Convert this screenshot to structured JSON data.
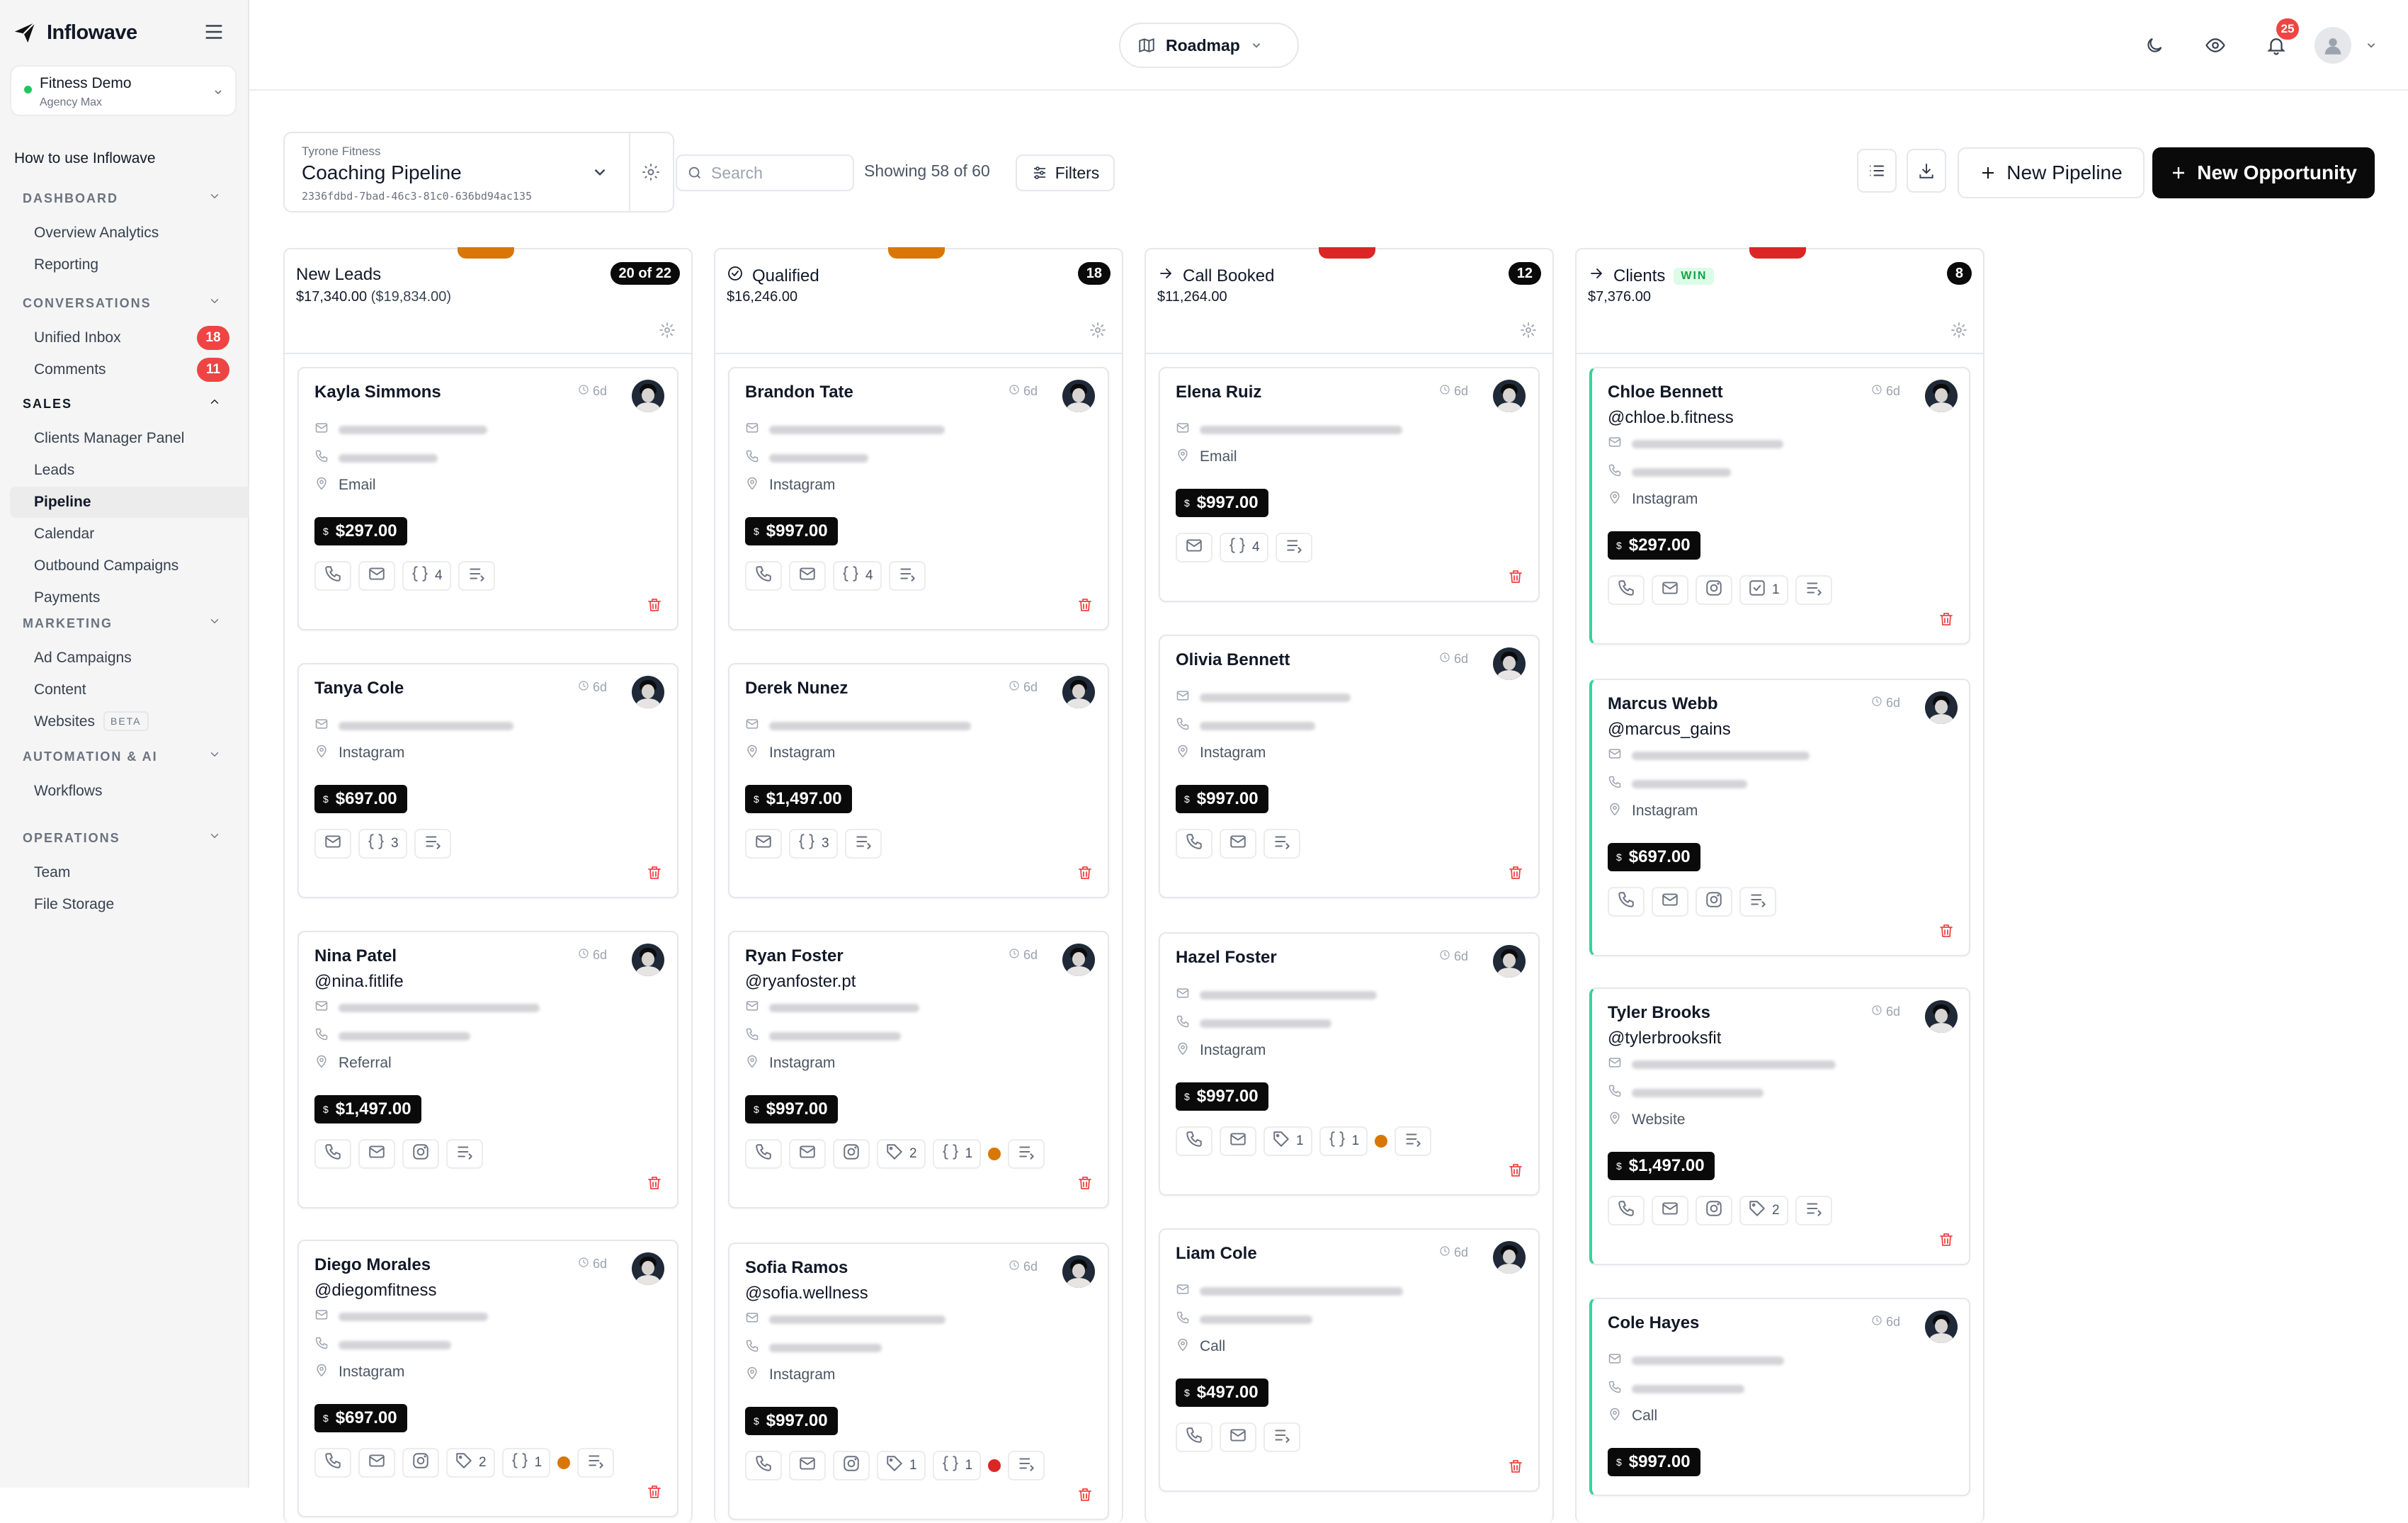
{
  "app": {
    "name": "Inflowave"
  },
  "account": {
    "name": "Fitness Demo",
    "plan": "Agency Max"
  },
  "howto": "How to use Inflowave",
  "sidebar": {
    "sections": [
      {
        "title": "DASHBOARD",
        "items": [
          "Overview Analytics",
          "Reporting"
        ]
      },
      {
        "title": "CONVERSATIONS",
        "items": [
          "Unified Inbox",
          "Comments"
        ],
        "badges": [
          "18",
          "11"
        ]
      },
      {
        "title": "SALES",
        "items": [
          "Clients Manager Panel",
          "Leads",
          "Pipeline",
          "Calendar",
          "Outbound Campaigns",
          "Payments"
        ],
        "active": "Pipeline"
      },
      {
        "title": "MARKETING",
        "items": [
          "Ad Campaigns",
          "Content",
          "Websites"
        ],
        "beta": "BETA"
      },
      {
        "title": "AUTOMATION & AI",
        "items": [
          "Workflows"
        ]
      },
      {
        "title": "OPERATIONS",
        "items": [
          "Team",
          "File Storage"
        ]
      }
    ]
  },
  "topbar": {
    "roadmap": "Roadmap",
    "notifications": "25"
  },
  "pipeline": {
    "owner": "Tyrone Fitness",
    "name": "Coaching Pipeline",
    "id": "2336fdbd-7bad-46c3-81c0-636bd94ac135",
    "search_placeholder": "Search",
    "showing": "Showing 58 of 60",
    "filters": "Filters",
    "new_pipeline": "New Pipeline",
    "new_opportunity": "New Opportunity"
  },
  "columns": [
    {
      "title": "New Leads",
      "amount": "$17,340.00",
      "sub": "($19,834.00)",
      "count": "20 of 22",
      "tab_color": "#d97706",
      "cards": [
        {
          "name": "Kayla Simmons",
          "age": "6d",
          "source": "Email",
          "price": "$297.00",
          "actions": [
            {
              "t": "phone"
            },
            {
              "t": "mail"
            },
            {
              "t": "code",
              "n": "4"
            },
            {
              "t": "notes"
            }
          ]
        },
        {
          "name": "Tanya Cole",
          "age": "6d",
          "source": "Instagram",
          "price": "$697.00",
          "nophone": true,
          "actions": [
            {
              "t": "mail"
            },
            {
              "t": "code",
              "n": "3"
            },
            {
              "t": "notes"
            }
          ]
        },
        {
          "name": "Nina Patel",
          "handle": "@nina.fitlife",
          "age": "6d",
          "source": "Referral",
          "price": "$1,497.00",
          "actions": [
            {
              "t": "phone"
            },
            {
              "t": "mail"
            },
            {
              "t": "insta"
            },
            {
              "t": "notes"
            }
          ]
        },
        {
          "name": "Diego Morales",
          "handle": "@diegomfitness",
          "age": "6d",
          "source": "Instagram",
          "price": "$697.00",
          "actions": [
            {
              "t": "phone"
            },
            {
              "t": "mail"
            },
            {
              "t": "insta"
            },
            {
              "t": "tag",
              "n": "2"
            },
            {
              "t": "code",
              "n": "1"
            },
            {
              "t": "dot",
              "c": "#d97706"
            },
            {
              "t": "notes"
            }
          ]
        }
      ]
    },
    {
      "title": "Qualified",
      "amount": "$16,246.00",
      "count": "18",
      "tab_color": "#d97706",
      "cards": [
        {
          "name": "Brandon Tate",
          "age": "6d",
          "source": "Instagram",
          "price": "$997.00",
          "actions": [
            {
              "t": "phone"
            },
            {
              "t": "mail"
            },
            {
              "t": "code",
              "n": "4"
            },
            {
              "t": "notes"
            }
          ]
        },
        {
          "name": "Derek Nunez",
          "age": "6d",
          "source": "Instagram",
          "price": "$1,497.00",
          "nophone": true,
          "actions": [
            {
              "t": "mail"
            },
            {
              "t": "code",
              "n": "3"
            },
            {
              "t": "notes"
            }
          ]
        },
        {
          "name": "Ryan Foster",
          "handle": "@ryanfoster.pt",
          "age": "6d",
          "source": "Instagram",
          "price": "$997.00",
          "actions": [
            {
              "t": "phone"
            },
            {
              "t": "mail"
            },
            {
              "t": "insta"
            },
            {
              "t": "tag",
              "n": "2"
            },
            {
              "t": "code",
              "n": "1"
            },
            {
              "t": "dot",
              "c": "#d97706"
            },
            {
              "t": "notes"
            }
          ]
        },
        {
          "name": "Sofia Ramos",
          "handle": "@sofia.wellness",
          "age": "6d",
          "source": "Instagram",
          "price": "$997.00",
          "actions": [
            {
              "t": "phone"
            },
            {
              "t": "mail"
            },
            {
              "t": "insta"
            },
            {
              "t": "tag",
              "n": "1"
            },
            {
              "t": "code",
              "n": "1"
            },
            {
              "t": "dot",
              "c": "#dc2626"
            },
            {
              "t": "notes"
            }
          ]
        }
      ]
    },
    {
      "title": "Call Booked",
      "amount": "$11,264.00",
      "count": "12",
      "tab_color": "#dc2626",
      "cards": [
        {
          "name": "Elena Ruiz",
          "age": "6d",
          "source": "Email",
          "price": "$997.00",
          "nophone": true,
          "actions": [
            {
              "t": "mail"
            },
            {
              "t": "code",
              "n": "4"
            },
            {
              "t": "notes"
            }
          ]
        },
        {
          "name": "Olivia Bennett",
          "age": "6d",
          "source": "Instagram",
          "price": "$997.00",
          "actions": [
            {
              "t": "phone"
            },
            {
              "t": "mail"
            },
            {
              "t": "notes"
            }
          ]
        },
        {
          "name": "Hazel Foster",
          "age": "6d",
          "source": "Instagram",
          "price": "$997.00",
          "actions": [
            {
              "t": "phone"
            },
            {
              "t": "mail"
            },
            {
              "t": "tag",
              "n": "1"
            },
            {
              "t": "code",
              "n": "1"
            },
            {
              "t": "dot",
              "c": "#d97706"
            },
            {
              "t": "notes"
            }
          ]
        },
        {
          "name": "Liam Cole",
          "age": "6d",
          "source": "Call",
          "price": "$497.00",
          "actions": [
            {
              "t": "phone"
            },
            {
              "t": "mail"
            },
            {
              "t": "notes"
            }
          ]
        }
      ]
    },
    {
      "title": "Clients",
      "amount": "$7,376.00",
      "count": "8",
      "win": "WIN",
      "tab_color": "#dc2626",
      "cards": [
        {
          "name": "Chloe Bennett",
          "handle": "@chloe.b.fitness",
          "age": "6d",
          "source": "Instagram",
          "price": "$297.00",
          "actions": [
            {
              "t": "phone"
            },
            {
              "t": "mail"
            },
            {
              "t": "insta"
            },
            {
              "t": "check",
              "n": "1"
            },
            {
              "t": "notes"
            }
          ]
        },
        {
          "name": "Marcus Webb",
          "handle": "@marcus_gains",
          "age": "6d",
          "source": "Instagram",
          "price": "$697.00",
          "actions": [
            {
              "t": "phone"
            },
            {
              "t": "mail"
            },
            {
              "t": "insta"
            },
            {
              "t": "notes"
            }
          ]
        },
        {
          "name": "Tyler Brooks",
          "handle": "@tylerbrooksfit",
          "age": "6d",
          "source": "Website",
          "price": "$1,497.00",
          "actions": [
            {
              "t": "phone"
            },
            {
              "t": "mail"
            },
            {
              "t": "insta"
            },
            {
              "t": "tag",
              "n": "2"
            },
            {
              "t": "notes"
            }
          ]
        },
        {
          "name": "Cole Hayes",
          "age": "6d",
          "source": "Call",
          "price": "$997.00",
          "actions": []
        }
      ]
    }
  ]
}
